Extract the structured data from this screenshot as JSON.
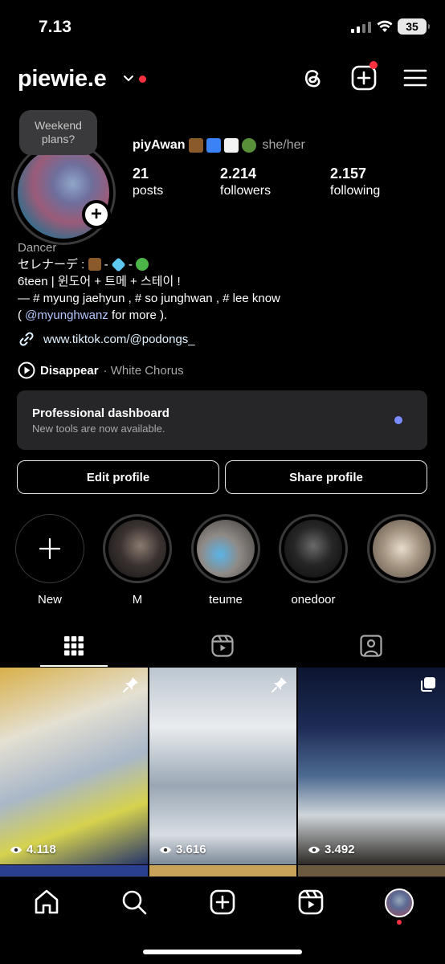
{
  "status": {
    "time": "7.13",
    "battery": "35"
  },
  "header": {
    "username": "piewie.e"
  },
  "profile": {
    "note_bubble": "Weekend plans?",
    "display_name": "piyAwan",
    "pronouns": "she/her",
    "stats": [
      {
        "value": "21",
        "label": "posts"
      },
      {
        "value": "2.214",
        "label": "followers"
      },
      {
        "value": "2.157",
        "label": "following"
      }
    ],
    "category": "Dancer",
    "bio_line1_prefix": "セレナーデ :",
    "bio_line1_sep": "-",
    "bio_line2": "6teen | 윈도어 + 트메 + 스테이 !",
    "bio_line3": "— # myung jaehyun , # so junghwan , # lee know",
    "bio_line4_open": "( ",
    "bio_mention": "@myunghwanz",
    "bio_line4_close": " for more ).",
    "link": "www.tiktok.com/@podongs_",
    "song": "Disappear",
    "artist": "· White Chorus"
  },
  "dashboard": {
    "title": "Professional dashboard",
    "subtitle": "New tools are now available."
  },
  "buttons": {
    "edit": "Edit profile",
    "share": "Share profile"
  },
  "highlights": [
    {
      "label": "New"
    },
    {
      "label": "M"
    },
    {
      "label": "teume"
    },
    {
      "label": "onedoor"
    },
    {
      "label": ""
    }
  ],
  "posts": [
    {
      "views": "4.118"
    },
    {
      "views": "3.616"
    },
    {
      "views": "3.492"
    }
  ],
  "colors": {
    "accent_red": "#ff3040",
    "mention": "#b4c7ff",
    "dashboard_dot": "#7a8cff"
  }
}
